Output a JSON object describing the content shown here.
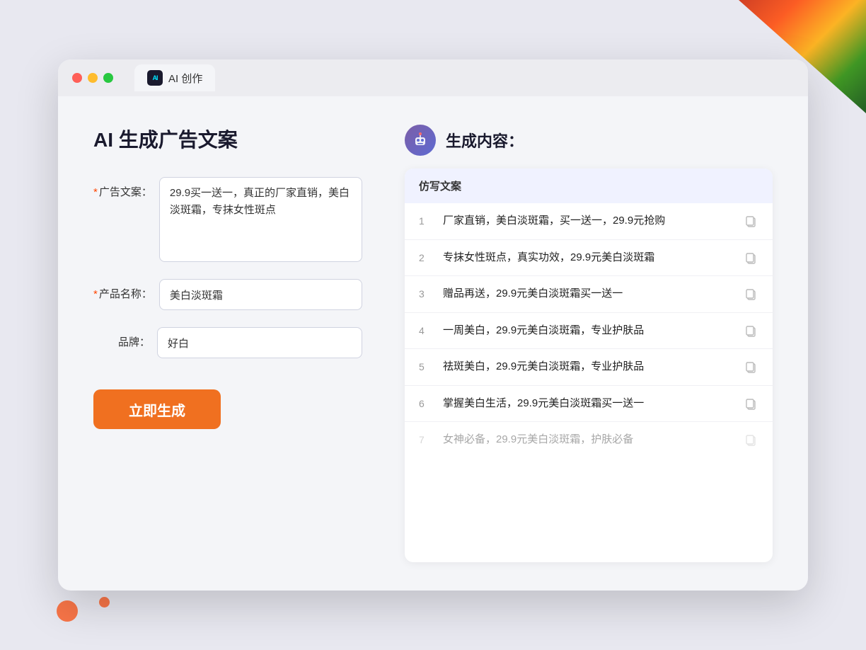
{
  "browser": {
    "tab_icon_label": "AI",
    "tab_label": "AI 创作"
  },
  "left_panel": {
    "page_title": "AI 生成广告文案",
    "form": {
      "ad_copy_label": "广告文案：",
      "ad_copy_required": "*",
      "ad_copy_value": "29.9买一送一，真正的厂家直销，美白淡斑霜，专抹女性斑点",
      "product_name_label": "产品名称：",
      "product_name_required": "*",
      "product_name_value": "美白淡斑霜",
      "brand_label": "品牌：",
      "brand_value": "好白"
    },
    "generate_button": "立即生成"
  },
  "right_panel": {
    "header_title": "生成内容：",
    "results_header": "仿写文案",
    "results": [
      {
        "num": "1",
        "text": "厂家直销，美白淡斑霜，买一送一，29.9元抢购",
        "dimmed": false
      },
      {
        "num": "2",
        "text": "专抹女性斑点，真实功效，29.9元美白淡斑霜",
        "dimmed": false
      },
      {
        "num": "3",
        "text": "赠品再送，29.9元美白淡斑霜买一送一",
        "dimmed": false
      },
      {
        "num": "4",
        "text": "一周美白，29.9元美白淡斑霜，专业护肤品",
        "dimmed": false
      },
      {
        "num": "5",
        "text": "祛斑美白，29.9元美白淡斑霜，专业护肤品",
        "dimmed": false
      },
      {
        "num": "6",
        "text": "掌握美白生活，29.9元美白淡斑霜买一送一",
        "dimmed": false
      },
      {
        "num": "7",
        "text": "女神必备，29.9元美白淡斑霜，护肤必备",
        "dimmed": true
      }
    ]
  },
  "icons": {
    "robot": "🤖",
    "copy": "copy-icon"
  }
}
